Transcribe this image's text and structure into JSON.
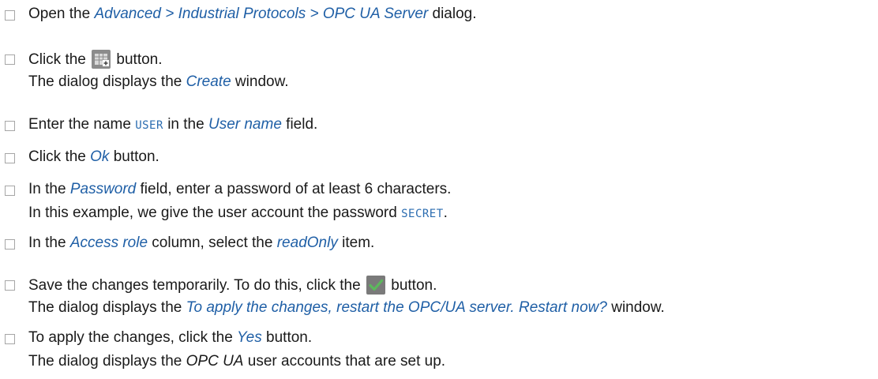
{
  "steps": [
    {
      "l1_a": "Open the ",
      "l1_b": "Advanced > Industrial Protocols > OPC UA Server",
      "l1_c": " dialog."
    },
    {
      "l1_a": "Click the ",
      "icon": "table-add-icon",
      "l1_c": " button.",
      "l2_a": "The dialog displays the ",
      "l2_b": "Create",
      "l2_c": " window."
    },
    {
      "l1_a": "Enter the name ",
      "l1_code": "USER",
      "l1_b": " in the ",
      "l1_em": "User name",
      "l1_c": " field."
    },
    {
      "l1_a": "Click the ",
      "l1_em": "Ok",
      "l1_c": " button."
    },
    {
      "l1_a": "In the ",
      "l1_em": "Password",
      "l1_c": " field, enter a password of at least 6 characters.",
      "l2_a": "In this example, we give the user account the password ",
      "l2_code": "SECRET",
      "l2_c": "."
    },
    {
      "l1_a": "In the ",
      "l1_em": "Access role",
      "l1_b": " column, select the ",
      "l1_em2": "readOnly",
      "l1_c": " item."
    },
    {
      "l1_a": "Save the changes temporarily. To do this, click the ",
      "icon": "checkmark-icon",
      "l1_c": " button.",
      "l2_a": "The dialog displays the ",
      "l2_b": "To apply the changes, restart the OPC/UA server. Restart now?",
      "l2_c": " window."
    },
    {
      "l1_a": "To apply the changes, click the ",
      "l1_em": "Yes",
      "l1_c": " button.",
      "l2_a": "The dialog displays the ",
      "l2_b": "OPC UA",
      "l2_c": " user accounts that are set up."
    }
  ],
  "colors": {
    "emphasis": "#1f5fa6",
    "code": "#2b6cb0",
    "checkbox_border": "#a6a6a6",
    "check_button": "#7a7a7a",
    "check_mark": "#5cb85c"
  }
}
